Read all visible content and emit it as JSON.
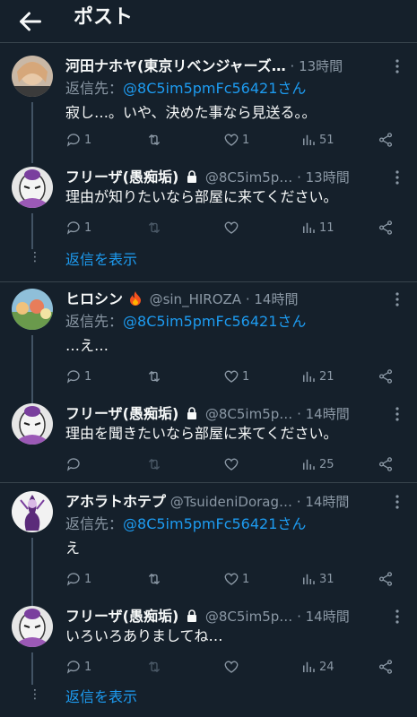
{
  "header": {
    "title": "ポスト"
  },
  "tweets": [
    {
      "name": "河田ナホヤ(東京リベンジャーズ…",
      "handle": "",
      "time": "13時間",
      "reply_prefix": "返信先：",
      "reply_mention": "@8C5im5pmFc56421さん",
      "text": "寂し…。いや、決めた事なら見送る。。",
      "reply_count": "1",
      "retweet_count": "",
      "like_count": "1",
      "view_count": "51"
    },
    {
      "name": "フリーザ(愚痴垢)",
      "handle": "@8C5im5p…",
      "time": "13時間",
      "text": "理由が知りたいなら部屋に来てください。",
      "reply_count": "1",
      "retweet_count": "",
      "like_count": "",
      "view_count": "11"
    },
    {
      "name": "ヒロシン",
      "handle": "@sin_HIROZA",
      "time": "14時間",
      "reply_prefix": "返信先：",
      "reply_mention": "@8C5im5pmFc56421さん",
      "text": "…え…",
      "reply_count": "1",
      "retweet_count": "",
      "like_count": "1",
      "view_count": "21"
    },
    {
      "name": "フリーザ(愚痴垢)",
      "handle": "@8C5im5p…",
      "time": "14時間",
      "text": "理由を聞きたいなら部屋に来てください。",
      "reply_count": "",
      "retweet_count": "",
      "like_count": "",
      "view_count": "25"
    },
    {
      "name": "アホラトホテプ",
      "handle": "@TsuideniDorag…",
      "time": "14時間",
      "reply_prefix": "返信先：",
      "reply_mention": "@8C5im5pmFc56421さん",
      "text": "え",
      "reply_count": "1",
      "retweet_count": "",
      "like_count": "1",
      "view_count": "31"
    },
    {
      "name": "フリーザ(愚痴垢)",
      "handle": "@8C5im5p…",
      "time": "14時間",
      "text": "いろいろありましてね…",
      "reply_count": "1",
      "retweet_count": "",
      "like_count": "",
      "view_count": "24"
    }
  ],
  "show_replies_label": "返信を表示",
  "mid_dot": "·",
  "colors": {
    "background": "#15202b",
    "accent": "#1d9bf0",
    "muted": "#8b98a5",
    "divider": "#38444d"
  }
}
